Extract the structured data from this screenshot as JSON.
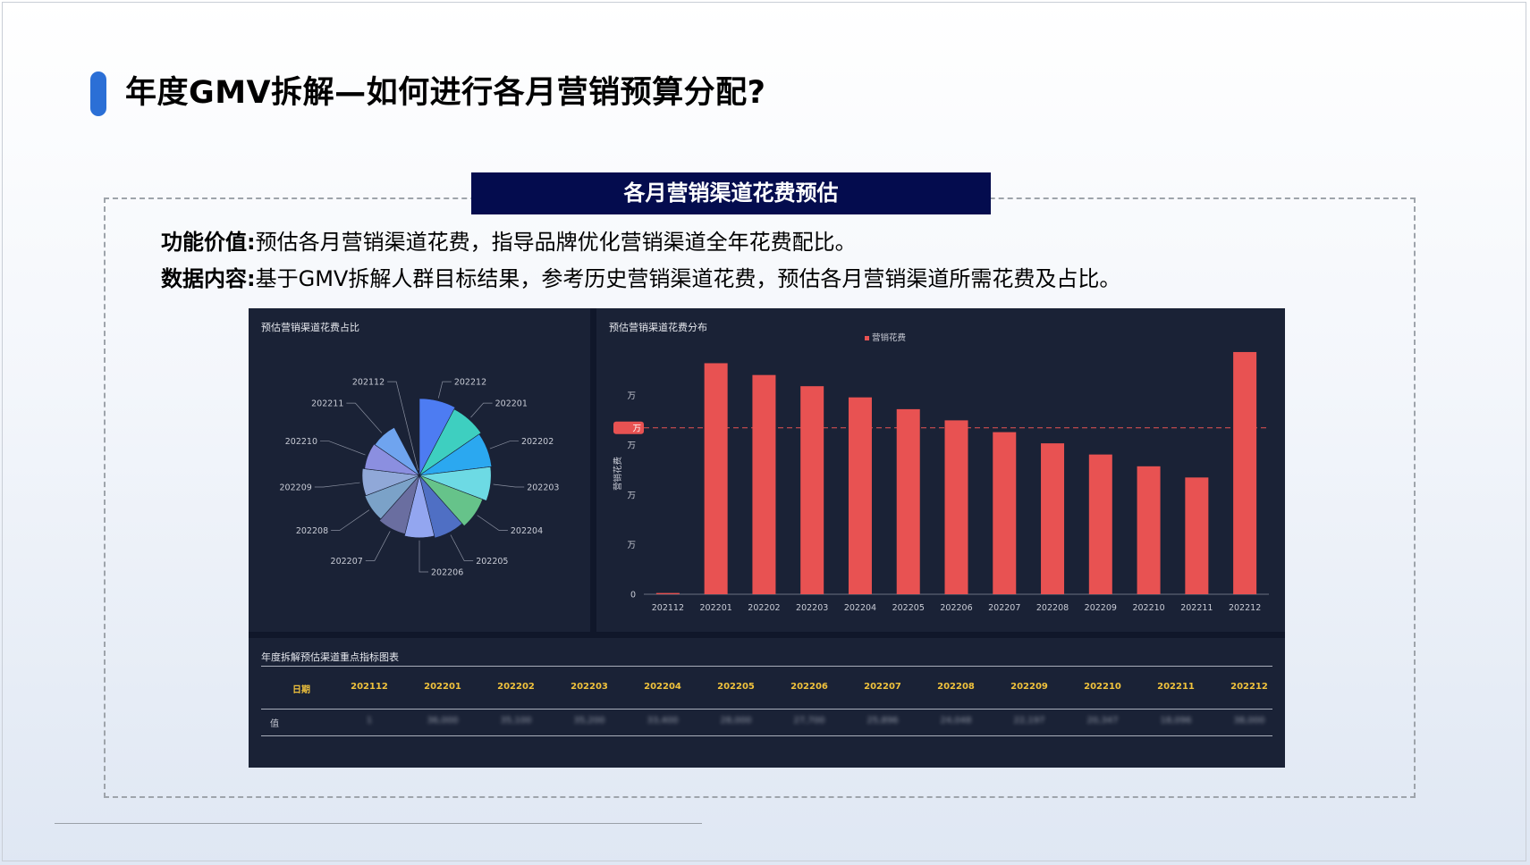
{
  "slide": {
    "title": "年度GMV拆解—如何进行各月营销预算分配?",
    "section_title": "各月营销渠道花费预估",
    "value_label": "功能价值:",
    "value_text": "预估各月营销渠道花费，指导品牌优化营销渠道全年花费配比。",
    "content_label": "数据内容:",
    "content_text": "基于GMV拆解人群目标结果，参考历史营销渠道花费，预估各月营销渠道所需花费及占比。"
  },
  "dashboard": {
    "pie_title": "预估营销渠道花费占比",
    "bar_title": "预估营销渠道花费分布",
    "table_title": "年度拆解预估渠道重点指标图表",
    "table": {
      "header_label": "日期",
      "row_label": "值",
      "columns": [
        "202112",
        "202201",
        "202202",
        "202203",
        "202204",
        "202205",
        "202206",
        "202207",
        "202208",
        "202209",
        "202210",
        "202211",
        "202212"
      ],
      "values": [
        "1",
        "36,000",
        "35,100",
        "35,200",
        "33,400",
        "28,000",
        "27,700",
        "25,896",
        "24,048",
        "22,197",
        "20,347",
        "18,096",
        "38,000"
      ]
    }
  },
  "chart_data": [
    {
      "type": "pie",
      "title": "预估营销渠道花费占比",
      "categories": [
        "202212",
        "202201",
        "202202",
        "202203",
        "202204",
        "202205",
        "202206",
        "202207",
        "202208",
        "202209",
        "202210",
        "202211",
        "202112"
      ],
      "values": [
        38,
        36,
        34,
        33,
        29,
        26,
        24,
        22,
        20,
        19,
        17,
        16,
        0.5
      ],
      "colors": [
        "#4d7cf2",
        "#3ecfc0",
        "#2ba8f0",
        "#6ddae4",
        "#66c38a",
        "#4f6fc4",
        "#93a6f0",
        "#6a6ea0",
        "#7ba2c8",
        "#90a8d8",
        "#8b8fe0",
        "#6fa4ef",
        "#5a6070"
      ],
      "note": "rose/nightingale chart: radius ∝ value"
    },
    {
      "type": "bar",
      "title": "预估营销渠道花费分布",
      "legend": [
        "营销花费"
      ],
      "legend_position": "top",
      "ylabel": "营销花费",
      "ytick_labels": [
        "0",
        "万",
        "万",
        "万",
        "万"
      ],
      "reference_line_label": "万",
      "reference_value": 26.8,
      "ylim": [
        0,
        40
      ],
      "categories": [
        "202112",
        "202201",
        "202202",
        "202203",
        "202204",
        "202205",
        "202206",
        "202207",
        "202208",
        "202209",
        "202210",
        "202211",
        "202212"
      ],
      "series": [
        {
          "name": "营销花费",
          "color": "#e85252",
          "values": [
            0.2,
            37.2,
            35.3,
            33.5,
            31.7,
            29.8,
            28.0,
            26.1,
            24.3,
            22.5,
            20.6,
            18.8,
            39.0
          ]
        }
      ],
      "grid": false
    }
  ]
}
